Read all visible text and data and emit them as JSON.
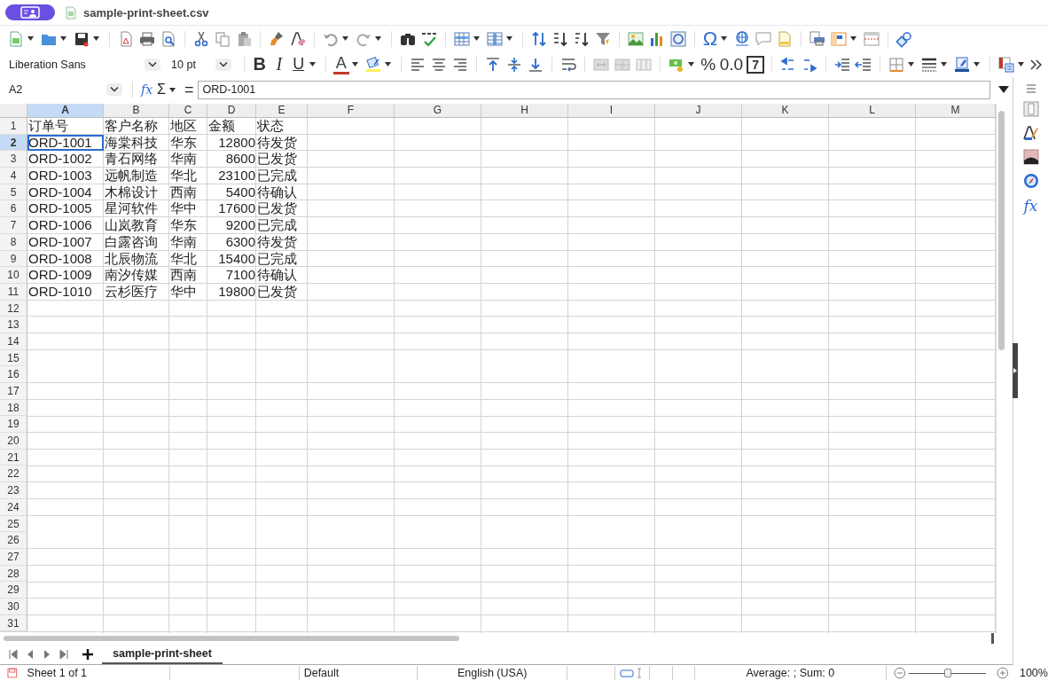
{
  "title_bar": {
    "file_name": "sample-print-sheet.csv"
  },
  "toolbar": {
    "special_character": "Ω"
  },
  "format_bar": {
    "font_name": "Liberation Sans",
    "font_size": "10 pt",
    "bold": "B",
    "italic": "I",
    "underline": "U",
    "font_color": "A",
    "percent": "%",
    "decimal": "0.0",
    "number_format": "7"
  },
  "formula_bar": {
    "name_box": "A2",
    "function_wizard": "fx",
    "sum": "Σ",
    "equals": "=",
    "content": "ORD-1001"
  },
  "sheet": {
    "columns": [
      {
        "letter": "A",
        "selected": true
      },
      {
        "letter": "B",
        "selected": false
      },
      {
        "letter": "C",
        "selected": false
      },
      {
        "letter": "D",
        "selected": false
      },
      {
        "letter": "E",
        "selected": false
      },
      {
        "letter": "F",
        "selected": false
      },
      {
        "letter": "G",
        "selected": false
      },
      {
        "letter": "H",
        "selected": false
      },
      {
        "letter": "I",
        "selected": false
      },
      {
        "letter": "J",
        "selected": false
      },
      {
        "letter": "K",
        "selected": false
      },
      {
        "letter": "L",
        "selected": false
      },
      {
        "letter": "M",
        "selected": false
      }
    ],
    "rows": [
      {
        "label": "1",
        "selected": false,
        "cells": [
          {
            "text": "订单号",
            "kind": "text"
          },
          {
            "text": "客户名称",
            "kind": "text"
          },
          {
            "text": "地区",
            "kind": "text"
          },
          {
            "text": "金额",
            "kind": "text"
          },
          {
            "text": "状态",
            "kind": "text"
          }
        ]
      },
      {
        "label": "2",
        "selected": true,
        "cells": [
          {
            "text": "ORD-1001",
            "kind": "text"
          },
          {
            "text": "海棠科技",
            "kind": "text"
          },
          {
            "text": "华东",
            "kind": "text"
          },
          {
            "text": "12800",
            "kind": "number"
          },
          {
            "text": "待发货",
            "kind": "text"
          }
        ]
      },
      {
        "label": "3",
        "selected": false,
        "cells": [
          {
            "text": "ORD-1002",
            "kind": "text"
          },
          {
            "text": "青石网络",
            "kind": "text"
          },
          {
            "text": "华南",
            "kind": "text"
          },
          {
            "text": "8600",
            "kind": "number"
          },
          {
            "text": "已发货",
            "kind": "text"
          }
        ]
      },
      {
        "label": "4",
        "selected": false,
        "cells": [
          {
            "text": "ORD-1003",
            "kind": "text"
          },
          {
            "text": "远帆制造",
            "kind": "text"
          },
          {
            "text": "华北",
            "kind": "text"
          },
          {
            "text": "23100",
            "kind": "number"
          },
          {
            "text": "已完成",
            "kind": "text"
          }
        ]
      },
      {
        "label": "5",
        "selected": false,
        "cells": [
          {
            "text": "ORD-1004",
            "kind": "text"
          },
          {
            "text": "木棉设计",
            "kind": "text"
          },
          {
            "text": "西南",
            "kind": "text"
          },
          {
            "text": "5400",
            "kind": "number"
          },
          {
            "text": "待确认",
            "kind": "text"
          }
        ]
      },
      {
        "label": "6",
        "selected": false,
        "cells": [
          {
            "text": "ORD-1005",
            "kind": "text"
          },
          {
            "text": "星河软件",
            "kind": "text"
          },
          {
            "text": "华中",
            "kind": "text"
          },
          {
            "text": "17600",
            "kind": "number"
          },
          {
            "text": "已发货",
            "kind": "text"
          }
        ]
      },
      {
        "label": "7",
        "selected": false,
        "cells": [
          {
            "text": "ORD-1006",
            "kind": "text"
          },
          {
            "text": "山岚教育",
            "kind": "text"
          },
          {
            "text": "华东",
            "kind": "text"
          },
          {
            "text": "9200",
            "kind": "number"
          },
          {
            "text": "已完成",
            "kind": "text"
          }
        ]
      },
      {
        "label": "8",
        "selected": false,
        "cells": [
          {
            "text": "ORD-1007",
            "kind": "text"
          },
          {
            "text": "白露咨询",
            "kind": "text"
          },
          {
            "text": "华南",
            "kind": "text"
          },
          {
            "text": "6300",
            "kind": "number"
          },
          {
            "text": "待发货",
            "kind": "text"
          }
        ]
      },
      {
        "label": "9",
        "selected": false,
        "cells": [
          {
            "text": "ORD-1008",
            "kind": "text"
          },
          {
            "text": "北辰物流",
            "kind": "text"
          },
          {
            "text": "华北",
            "kind": "text"
          },
          {
            "text": "15400",
            "kind": "number"
          },
          {
            "text": "已完成",
            "kind": "text"
          }
        ]
      },
      {
        "label": "10",
        "selected": false,
        "cells": [
          {
            "text": "ORD-1009",
            "kind": "text"
          },
          {
            "text": "南汐传媒",
            "kind": "text"
          },
          {
            "text": "西南",
            "kind": "text"
          },
          {
            "text": "7100",
            "kind": "number"
          },
          {
            "text": "待确认",
            "kind": "text"
          }
        ]
      },
      {
        "label": "11",
        "selected": false,
        "cells": [
          {
            "text": "ORD-1010",
            "kind": "text"
          },
          {
            "text": "云杉医疗",
            "kind": "text"
          },
          {
            "text": "华中",
            "kind": "text"
          },
          {
            "text": "19800",
            "kind": "number"
          },
          {
            "text": "已发货",
            "kind": "text"
          }
        ]
      },
      {
        "label": "12",
        "selected": false
      },
      {
        "label": "13",
        "selected": false
      },
      {
        "label": "14",
        "selected": false
      },
      {
        "label": "15",
        "selected": false
      },
      {
        "label": "16",
        "selected": false
      },
      {
        "label": "17",
        "selected": false
      },
      {
        "label": "18",
        "selected": false
      },
      {
        "label": "19",
        "selected": false
      },
      {
        "label": "20",
        "selected": false
      },
      {
        "label": "21",
        "selected": false
      },
      {
        "label": "22",
        "selected": false
      },
      {
        "label": "23",
        "selected": false
      },
      {
        "label": "24",
        "selected": false
      },
      {
        "label": "25",
        "selected": false
      },
      {
        "label": "26",
        "selected": false
      },
      {
        "label": "27",
        "selected": false
      },
      {
        "label": "28",
        "selected": false
      },
      {
        "label": "29",
        "selected": false
      },
      {
        "label": "30",
        "selected": false
      },
      {
        "label": "31",
        "selected": false
      }
    ]
  },
  "sheet_tabs": [
    {
      "label": "sample-print-sheet",
      "selected": true
    }
  ],
  "sidebar": {
    "functions_label": "fx"
  },
  "status_bar": {
    "sheet_position": "Sheet 1 of 1",
    "page_style": "Default",
    "language": "English (USA)",
    "selection_stats": "Average: ; Sum: 0",
    "zoom": {
      "level": 0.5
    },
    "zoom_percent": "100%"
  }
}
